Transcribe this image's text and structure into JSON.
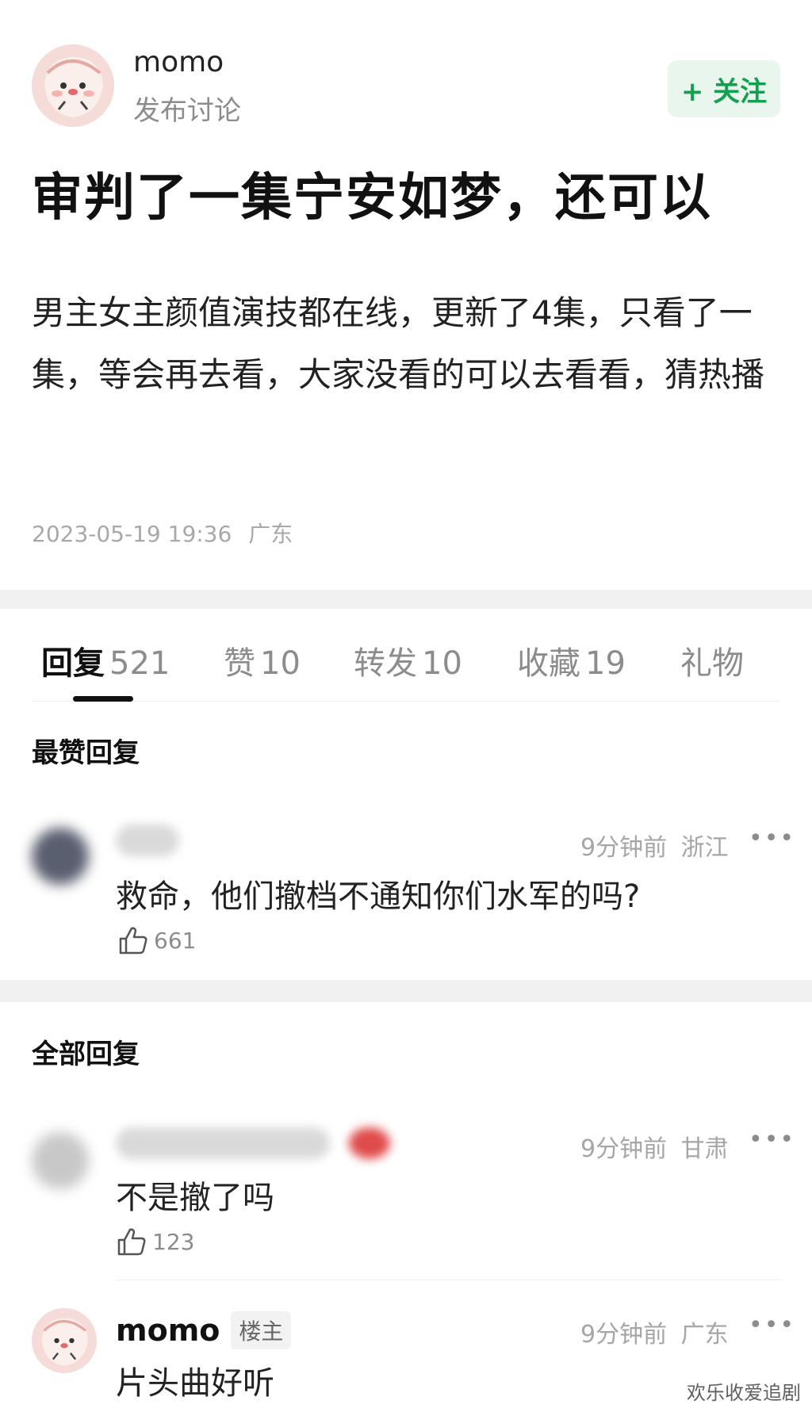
{
  "post": {
    "author": "momo",
    "subtitle": "发布讨论",
    "follow_label": "+ 关注",
    "title": "审判了一集宁安如梦，还可以",
    "body": "男主女主颜值演技都在线，更新了4集，只看了一集，等会再去看，大家没看的可以去看看，猜热播",
    "datetime": "2023-05-19 19:36",
    "location": "广东"
  },
  "tabs": [
    {
      "label": "回复",
      "count": "521"
    },
    {
      "label": "赞",
      "count": "10"
    },
    {
      "label": "转发",
      "count": "10"
    },
    {
      "label": "收藏",
      "count": "19"
    },
    {
      "label": "礼物",
      "count": ""
    }
  ],
  "sections": {
    "top": "最赞回复",
    "all": "全部回复"
  },
  "top_reply": {
    "time": "9分钟前",
    "location": "浙江",
    "text": "救命，他们撤档不通知你们水军的吗?",
    "likes": "661"
  },
  "replies": [
    {
      "time": "9分钟前",
      "location": "甘肃",
      "text": "不是撤了吗",
      "likes": "123"
    },
    {
      "name": "momo",
      "badge": "楼主",
      "time": "9分钟前",
      "location": "广东",
      "text": "片头曲好听"
    }
  ],
  "watermark": "欢乐收爱追剧",
  "colors": {
    "accent": "#12a150",
    "follow_bg": "#e9f6ee",
    "muted": "#a6a6a6"
  }
}
